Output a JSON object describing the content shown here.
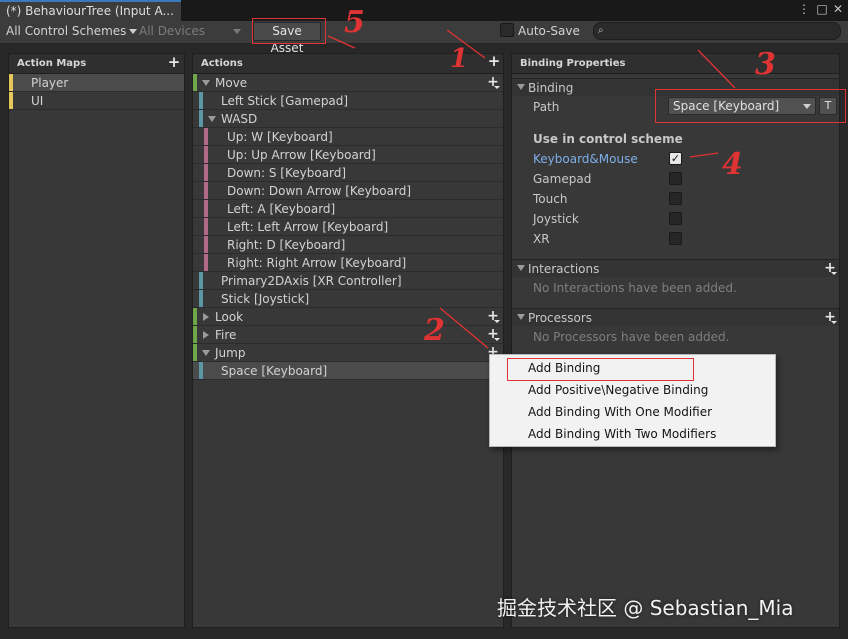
{
  "window": {
    "title": "(*) BehaviourTree (Input A...",
    "menu_icon": "more-vert-icon",
    "maximize_icon": "maximize-icon",
    "close_icon": "close-icon"
  },
  "toolbar": {
    "control_schemes": "All Control Schemes",
    "devices": "All Devices",
    "save_label": "Save Asset",
    "autosave_label": "Auto-Save",
    "search_icon": "search-icon"
  },
  "action_maps": {
    "header": "Action Maps",
    "items": [
      {
        "label": "Player",
        "selected": true
      },
      {
        "label": "UI",
        "selected": false
      }
    ]
  },
  "actions": {
    "header": "Actions",
    "rows": [
      {
        "label": "Move",
        "kind": "action"
      },
      {
        "label": "Left Stick [Gamepad]",
        "kind": "binding"
      },
      {
        "label": "WASD",
        "kind": "composite"
      },
      {
        "label": "Up: W [Keyboard]",
        "kind": "part"
      },
      {
        "label": "Up: Up Arrow [Keyboard]",
        "kind": "part"
      },
      {
        "label": "Down: S [Keyboard]",
        "kind": "part"
      },
      {
        "label": "Down: Down Arrow [Keyboard]",
        "kind": "part"
      },
      {
        "label": "Left: A [Keyboard]",
        "kind": "part"
      },
      {
        "label": "Left: Left Arrow [Keyboard]",
        "kind": "part"
      },
      {
        "label": "Right: D [Keyboard]",
        "kind": "part"
      },
      {
        "label": "Right: Right Arrow [Keyboard]",
        "kind": "part"
      },
      {
        "label": "Primary2DAxis [XR Controller]",
        "kind": "binding"
      },
      {
        "label": "Stick [Joystick]",
        "kind": "binding"
      },
      {
        "label": "Look",
        "kind": "action-collapsed"
      },
      {
        "label": "Fire",
        "kind": "action-collapsed"
      },
      {
        "label": "Jump",
        "kind": "action"
      },
      {
        "label": "Space [Keyboard]",
        "kind": "binding-selected"
      }
    ]
  },
  "binding_properties": {
    "header": "Binding Properties",
    "binding_section": "Binding",
    "path_label": "Path",
    "path_value": "Space [Keyboard]",
    "t_button": "T",
    "control_scheme_heading": "Use in control scheme",
    "schemes": [
      {
        "label": "Keyboard&Mouse",
        "checked": true
      },
      {
        "label": "Gamepad",
        "checked": false
      },
      {
        "label": "Touch",
        "checked": false
      },
      {
        "label": "Joystick",
        "checked": false
      },
      {
        "label": "XR",
        "checked": false
      }
    ],
    "interactions_section": "Interactions",
    "interactions_empty": "No Interactions have been added.",
    "processors_section": "Processors",
    "processors_empty": "No Processors have been added."
  },
  "context_menu": {
    "items": [
      "Add Binding",
      "Add Positive\\Negative Binding",
      "Add Binding With One Modifier",
      "Add Binding With Two Modifiers"
    ]
  },
  "annotations": [
    "1",
    "2",
    "3",
    "4",
    "5"
  ],
  "watermark": "掘金技术社区 @ Sebastian_Mia",
  "colors": {
    "background": "#282828",
    "panel": "#383838",
    "action_bar": "#6fa64a",
    "binding_bar": "#5b98a6",
    "part_bar": "#b06a86",
    "map_bar": "#e6c75b",
    "annotation_red": "#e03333",
    "scheme_link": "#7eaee8"
  }
}
